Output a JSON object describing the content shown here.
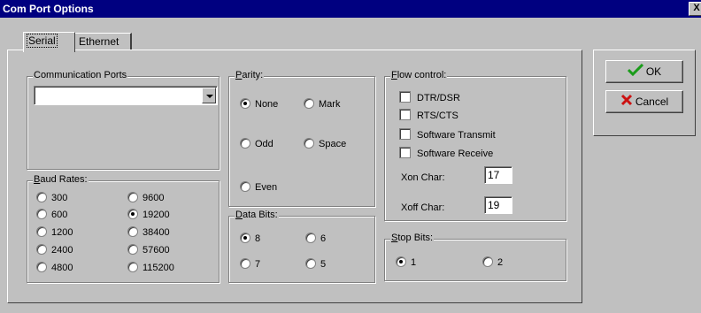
{
  "window": {
    "title": "Com Port Options",
    "close_label": "X"
  },
  "tabs": [
    {
      "label": "Serial",
      "active": true
    },
    {
      "label": "Ethernet",
      "active": false
    }
  ],
  "comm_ports": {
    "label": "Communication Ports",
    "value": ""
  },
  "parity": {
    "label_key": "P",
    "label_rest": "arity:",
    "options": [
      {
        "label": "None",
        "selected": true
      },
      {
        "label": "Mark",
        "selected": false
      },
      {
        "label": "Odd",
        "selected": false
      },
      {
        "label": "Space",
        "selected": false
      },
      {
        "label": "Even",
        "selected": false
      }
    ]
  },
  "flow_control": {
    "label_key": "F",
    "label_rest": "low control:",
    "options": [
      {
        "label": "DTR/DSR",
        "checked": false
      },
      {
        "label": "RTS/CTS",
        "checked": false
      },
      {
        "label": "Software Transmit",
        "checked": false
      },
      {
        "label": "Software Receive",
        "checked": false
      }
    ],
    "xon_label": "Xon Char:",
    "xon_value": "17",
    "xoff_label": "Xoff Char:",
    "xoff_value": "19"
  },
  "baud_rates": {
    "label_key": "B",
    "label_rest": "aud Rates:",
    "options": [
      {
        "label": "300",
        "selected": false
      },
      {
        "label": "600",
        "selected": false
      },
      {
        "label": "1200",
        "selected": false
      },
      {
        "label": "2400",
        "selected": false
      },
      {
        "label": "4800",
        "selected": false
      },
      {
        "label": "9600",
        "selected": false
      },
      {
        "label": "19200",
        "selected": true
      },
      {
        "label": "38400",
        "selected": false
      },
      {
        "label": "57600",
        "selected": false
      },
      {
        "label": "115200",
        "selected": false
      }
    ]
  },
  "data_bits": {
    "label_key": "D",
    "label_rest": "ata Bits:",
    "options": [
      {
        "label": "8",
        "selected": true
      },
      {
        "label": "6",
        "selected": false
      },
      {
        "label": "7",
        "selected": false
      },
      {
        "label": "5",
        "selected": false
      }
    ]
  },
  "stop_bits": {
    "label_key": "S",
    "label_rest": "top Bits:",
    "options": [
      {
        "label": "1",
        "selected": true
      },
      {
        "label": "2",
        "selected": false
      }
    ]
  },
  "buttons": {
    "ok": "OK",
    "cancel": "Cancel"
  },
  "colors": {
    "titlebar": "#000080",
    "face": "#c0c0c0",
    "ok_icon": "#1a9c1a",
    "cancel_icon": "#cc1111"
  }
}
